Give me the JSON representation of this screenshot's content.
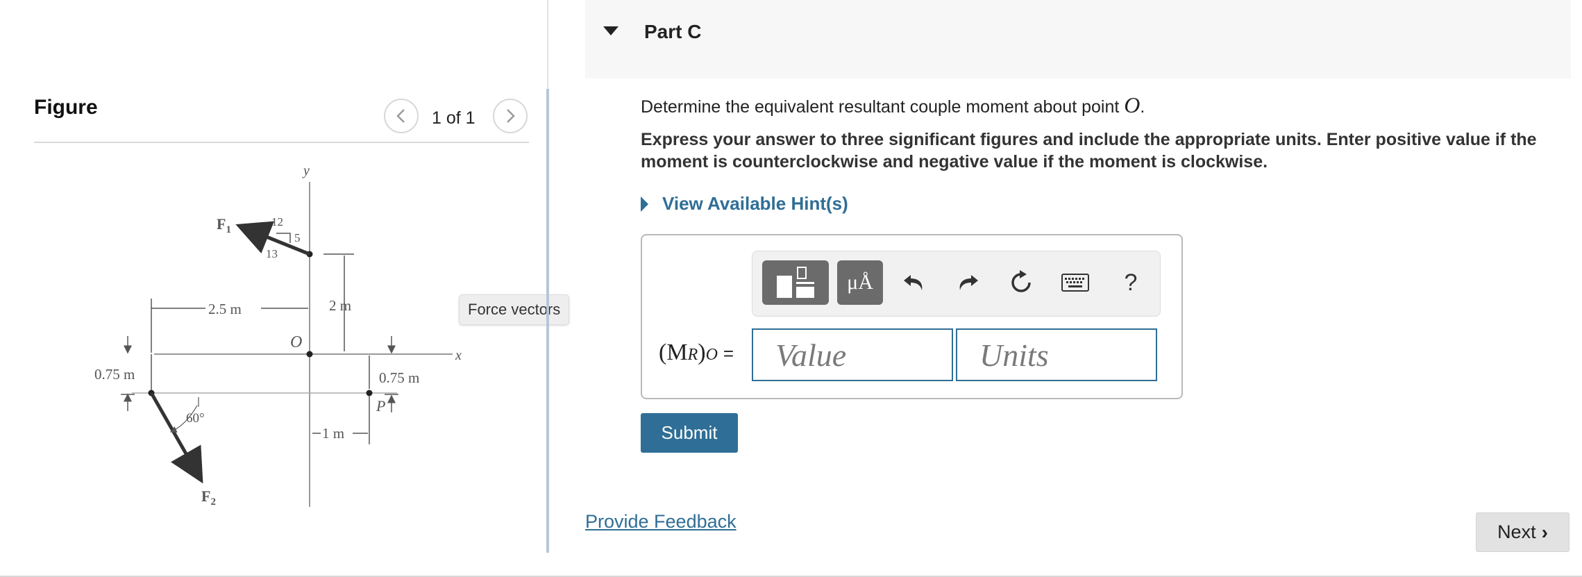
{
  "figure_panel": {
    "title": "Figure",
    "pagination": "1 of 1",
    "prev_icon": "chevron-left-icon",
    "next_icon": "chevron-right-icon",
    "tooltip": "Force vectors",
    "diagram": {
      "axis_y": "y",
      "axis_x": "x",
      "origin": "O",
      "force_1": "F",
      "force_1_sub": "1",
      "force_2": "F",
      "force_2_sub": "2",
      "point_p": "P",
      "slope_12": "12",
      "slope_5": "5",
      "slope_13": "13",
      "dim_2_5m": "2.5 m",
      "dim_2m": "2 m",
      "dim_0_75m_left": "0.75 m",
      "dim_0_75m_right": "0.75 m",
      "dim_1m": "1 m",
      "angle_60": "60°"
    }
  },
  "part": {
    "title": "Part C",
    "question_prefix": "Determine the equivalent resultant couple moment about point ",
    "question_var": "O",
    "question_suffix": ".",
    "instructions": "Express your answer to three significant figures and include the appropriate units. Enter positive value if the moment is counterclockwise and negative value if the moment is clockwise.",
    "hints_label": "View Available Hint(s)"
  },
  "answer": {
    "toolbar": {
      "templates_icon": "templates-icon",
      "units_label": "μÅ",
      "undo_icon": "undo-icon",
      "redo_icon": "redo-icon",
      "reset_icon": "reset-icon",
      "keyboard_icon": "keyboard-icon",
      "help_label": "?"
    },
    "label_main": "(M",
    "label_sub_r": "R",
    "label_close": ")",
    "label_sub_o": "O",
    "label_eq": "=",
    "value_placeholder": "Value",
    "units_placeholder": "Units",
    "submit_label": "Submit"
  },
  "footer": {
    "feedback_label": "Provide Feedback",
    "next_label": "Next"
  },
  "colors": {
    "accent": "#2f6e96",
    "toolbar_button": "#6b6b6b",
    "header_bg": "#f7f7f7"
  }
}
